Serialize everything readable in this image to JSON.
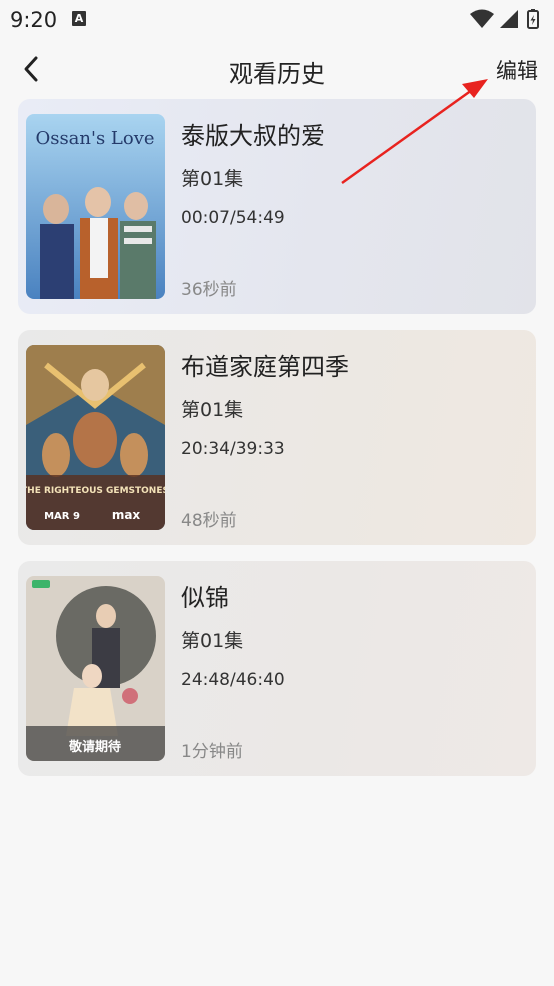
{
  "status_bar": {
    "time": "9:20",
    "notification_icon": "A"
  },
  "header": {
    "title": "观看历史",
    "edit_label": "编辑",
    "back_icon": "chevron-left-icon"
  },
  "history": [
    {
      "title": "泰版大叔的爱",
      "episode": "第01集",
      "progress": "00:07/54:49",
      "time_ago": "36秒前",
      "poster_text": "Ossan's Love"
    },
    {
      "title": "布道家庭第四季",
      "episode": "第01集",
      "progress": "20:34/39:33",
      "time_ago": "48秒前",
      "poster_text": "THE RIGHTEOUS GEMSTONES",
      "poster_subtext": "MAR 9",
      "poster_brand": "max"
    },
    {
      "title": "似锦",
      "episode": "第01集",
      "progress": "24:48/46:40",
      "time_ago": "1分钟前",
      "poster_text": "敬请期待"
    }
  ],
  "colors": {
    "annotation_arrow": "#e8231f",
    "text_primary": "#222222",
    "text_secondary": "#888888"
  }
}
